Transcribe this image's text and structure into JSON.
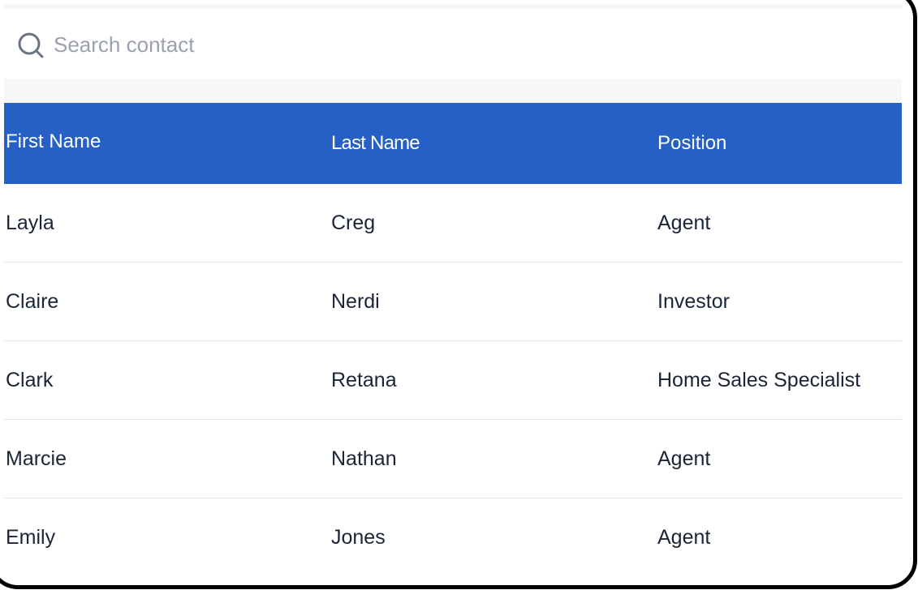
{
  "search": {
    "placeholder": "Search contact",
    "value": ""
  },
  "table": {
    "columns": [
      "First Name",
      "Last Name",
      "Position"
    ],
    "rows": [
      {
        "first_name": "Layla",
        "last_name": "Creg",
        "position": "Agent"
      },
      {
        "first_name": "Claire",
        "last_name": "Nerdi",
        "position": "Investor"
      },
      {
        "first_name": "Clark",
        "last_name": "Retana",
        "position": "Home Sales Specialist"
      },
      {
        "first_name": "Marcie",
        "last_name": "Nathan",
        "position": "Agent"
      },
      {
        "first_name": "Emily",
        "last_name": "Jones",
        "position": "Agent"
      }
    ]
  },
  "colors": {
    "header_background": "#2660c4",
    "header_text": "#ffffff",
    "body_text": "#1a2537",
    "placeholder_text": "#9aa1ad",
    "row_divider": "#dfe3e8",
    "strip_background": "#f6f7f9"
  },
  "icons": {
    "search": "search-icon"
  }
}
